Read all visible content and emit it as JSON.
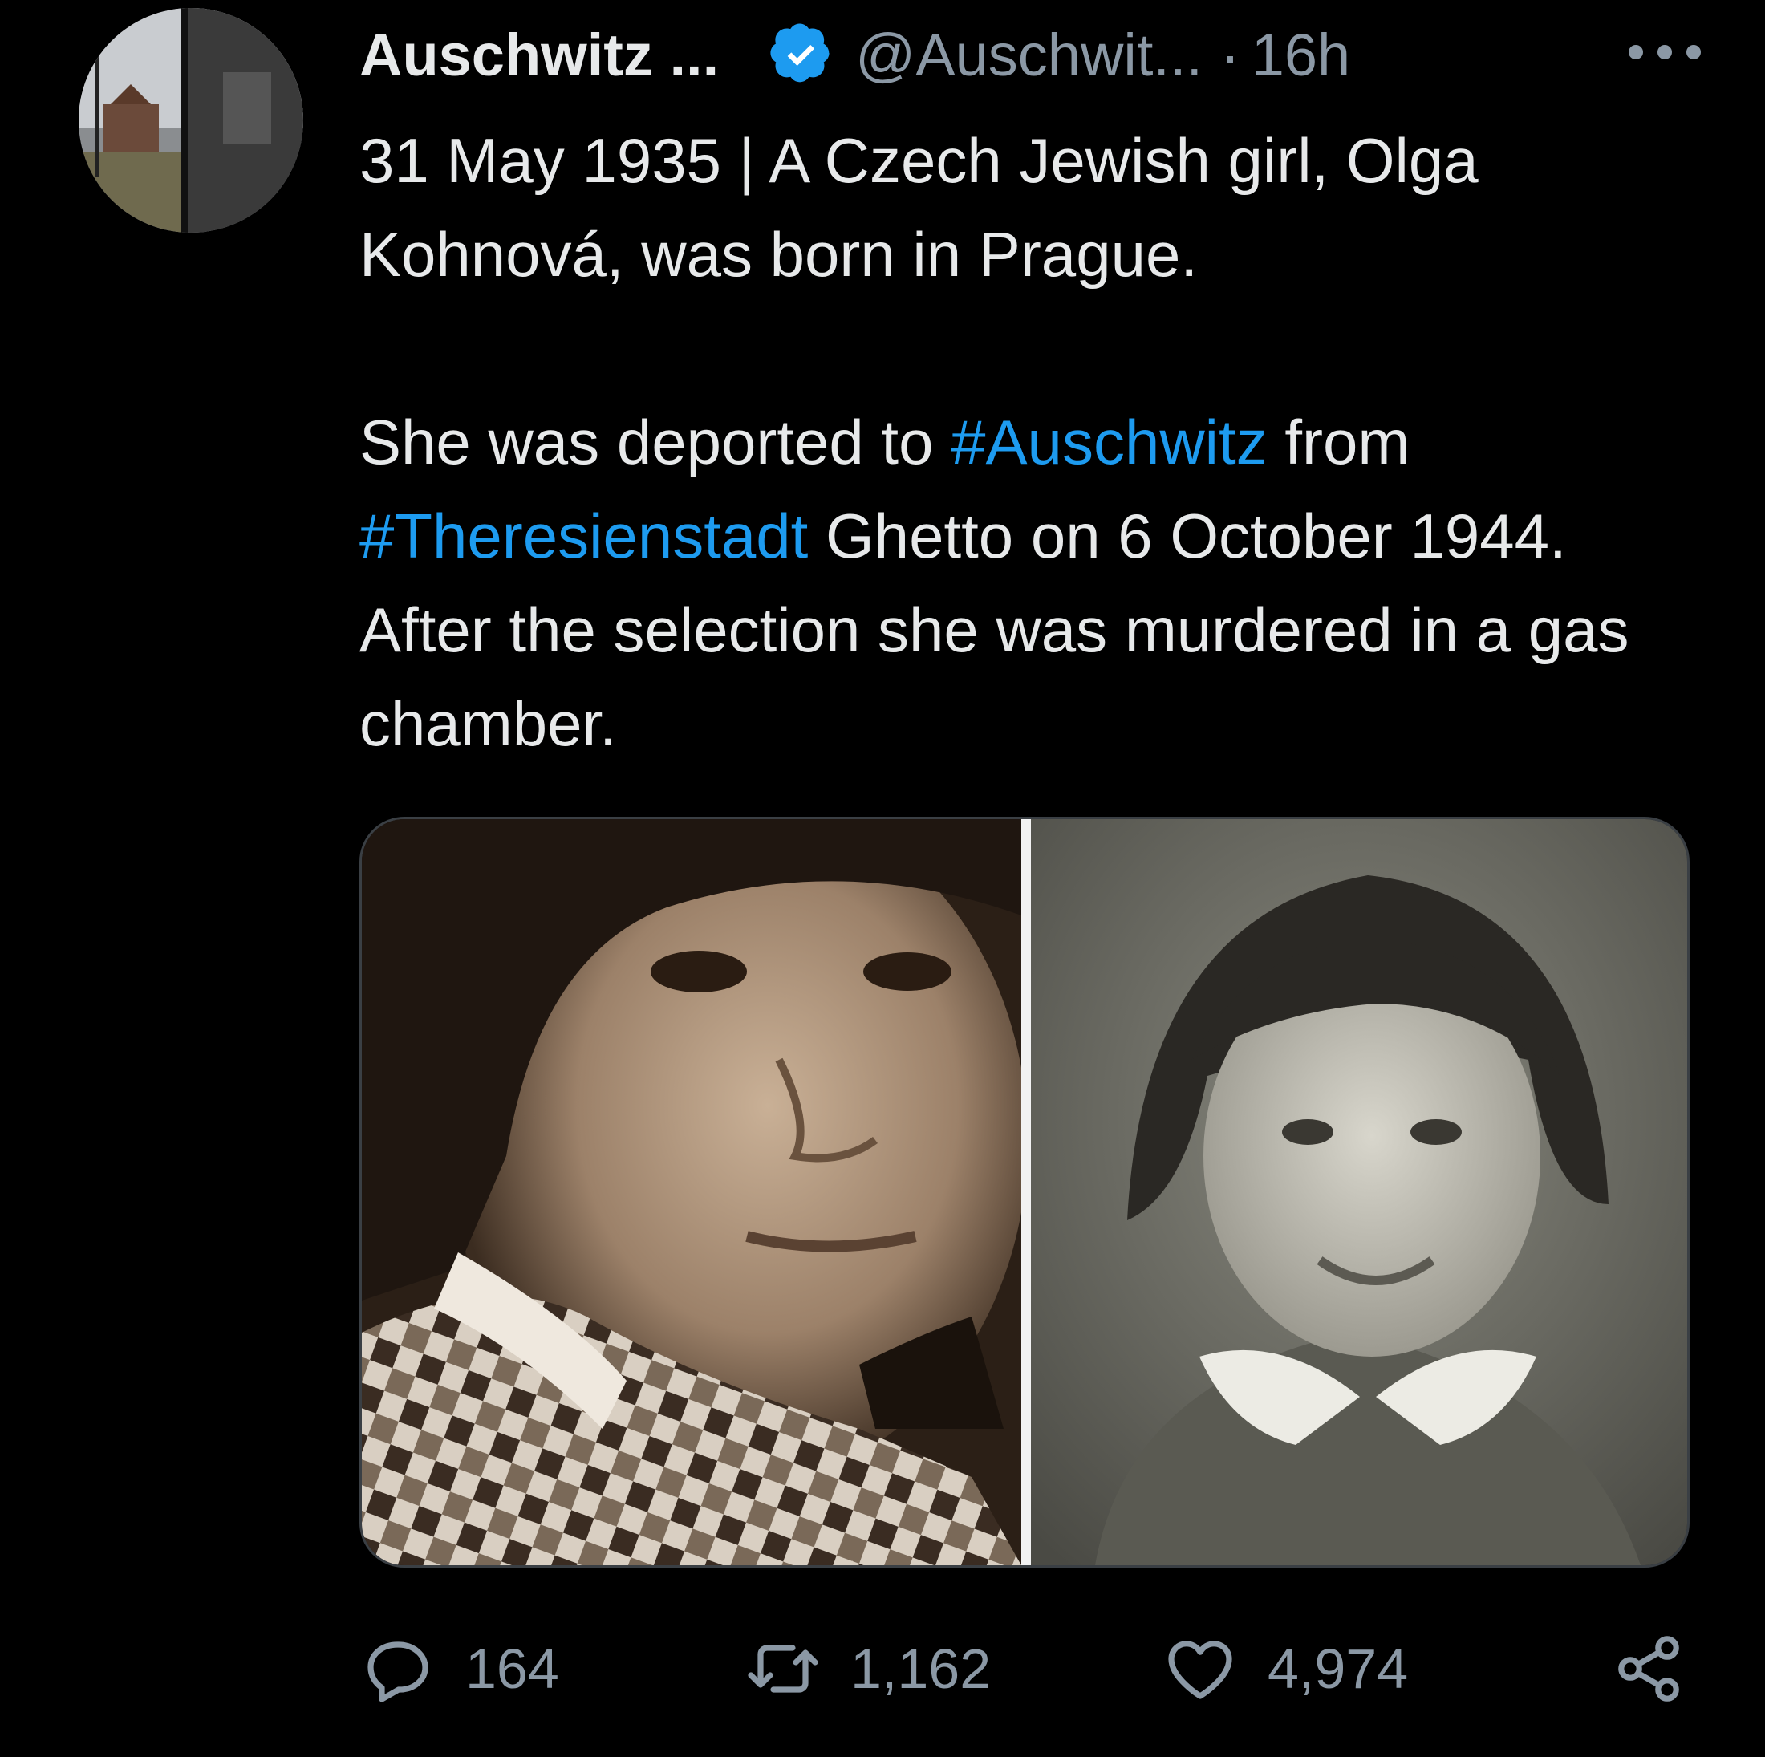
{
  "tweet": {
    "display_name": "Auschwitz ...",
    "handle": "@Auschwit...",
    "separator": "·",
    "time": "16h",
    "verified": true,
    "text_paragraph_1": "31 May 1935 | A Czech Jewish girl, Olga Kohnová, was born in Prague.",
    "text_paragraph_2": {
      "before": "She was deported to ",
      "hashtag_1": "#Auschwitz",
      "middle": " from ",
      "hashtag_2": "#Theresienstadt",
      "after": " Ghetto on 6 October 1944. After the selection she was murdered in a gas chamber."
    }
  },
  "media": {
    "photos": [
      "left-portrait",
      "right-portrait"
    ]
  },
  "actions": {
    "replies": "164",
    "retweets": "1,162",
    "likes": "4,974"
  },
  "icons": {
    "verified": "verified-badge-icon",
    "more": "more-options-icon",
    "reply": "reply-icon",
    "retweet": "retweet-icon",
    "like": "heart-icon",
    "share": "share-icon"
  },
  "colors": {
    "background": "#000000",
    "text": "#e7e9ea",
    "secondary_text": "#8b98a5",
    "link": "#1d9bf0",
    "verified_badge": "#1d9bf0"
  }
}
